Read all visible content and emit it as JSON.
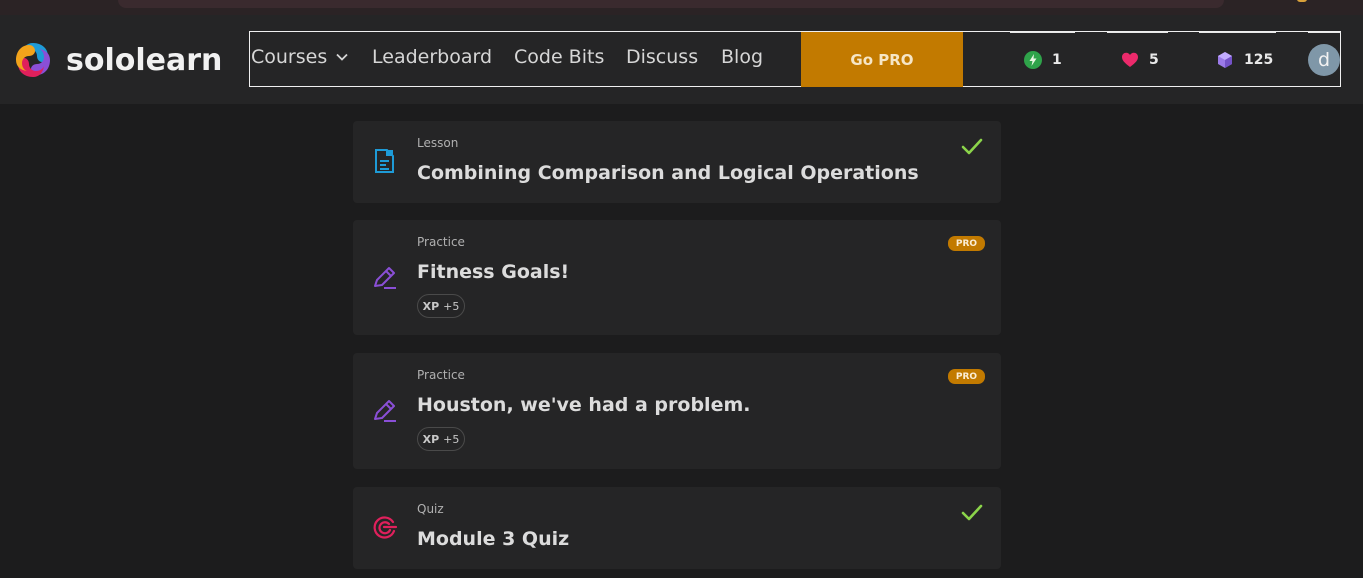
{
  "brand": {
    "name": "sololearn"
  },
  "nav": {
    "courses": "Courses",
    "leaderboard": "Leaderboard",
    "code_bits": "Code Bits",
    "discuss": "Discuss",
    "blog": "Blog",
    "go_pro": "Go PRO"
  },
  "stats": {
    "streak": "1",
    "hearts": "5",
    "gems": "125"
  },
  "user": {
    "avatar_initial": "d"
  },
  "items": [
    {
      "type": "Lesson",
      "title": "Combining Comparison and Logical Operations",
      "completed": true,
      "icon": "lesson-icon"
    },
    {
      "type": "Practice",
      "title": "Fitness Goals!",
      "badge": "PRO",
      "xp_label": "XP",
      "xp_value": "+5",
      "icon": "practice-icon"
    },
    {
      "type": "Practice",
      "title": "Houston, we've had a problem.",
      "badge": "PRO",
      "xp_label": "XP",
      "xp_value": "+5",
      "icon": "practice-icon"
    },
    {
      "type": "Quiz",
      "title": "Module 3 Quiz",
      "completed": true,
      "icon": "quiz-icon"
    }
  ],
  "colors": {
    "accent_pro": "#c27a00",
    "check_green": "#8bd44a",
    "lesson_blue": "#1e9bd7",
    "practice_purple": "#8a4fd6",
    "quiz_pink": "#e0205c"
  }
}
